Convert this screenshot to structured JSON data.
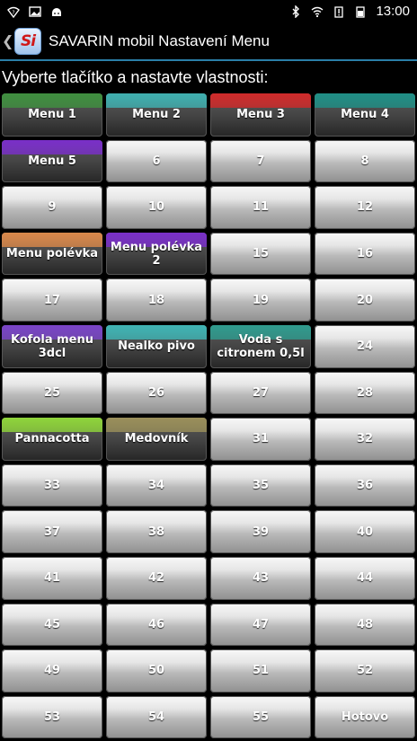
{
  "status_bar": {
    "left_icons": [
      "wifi-question-icon",
      "image-icon",
      "android-icon"
    ],
    "right_icons": [
      "bluetooth-icon",
      "wifi-icon",
      "battery-alert-icon",
      "battery-icon"
    ],
    "time": "13:00"
  },
  "action_bar": {
    "logo_text": "Si",
    "title": "SAVARIN mobil Nastavení Menu"
  },
  "instruction": "Vyberte tlačítko a nastavte vlastnosti:",
  "buttons": [
    {
      "label": "Menu 1",
      "color": "#3f8f3f"
    },
    {
      "label": "Menu 2",
      "color": "#3fb0b0"
    },
    {
      "label": "Menu 3",
      "color": "#d02a2a"
    },
    {
      "label": "Menu 4",
      "color": "#1f8f86"
    },
    {
      "label": "Menu 5",
      "color": "#7a2fc9"
    },
    {
      "label": "6"
    },
    {
      "label": "7"
    },
    {
      "label": "8"
    },
    {
      "label": "9"
    },
    {
      "label": "10"
    },
    {
      "label": "11"
    },
    {
      "label": "12"
    },
    {
      "label": "Menu polévka",
      "color": "#d9884a"
    },
    {
      "label": "Menu polévka 2",
      "color": "#7a2fc9"
    },
    {
      "label": "15"
    },
    {
      "label": "16"
    },
    {
      "label": "17"
    },
    {
      "label": "18"
    },
    {
      "label": "19"
    },
    {
      "label": "20"
    },
    {
      "label": "Kofola menu 3dcl",
      "color": "#7a44c8"
    },
    {
      "label": "Nealko pivo",
      "color": "#3fb5b5"
    },
    {
      "label": "Voda s citronem 0,5l",
      "color": "#2f9b8e"
    },
    {
      "label": "24"
    },
    {
      "label": "25"
    },
    {
      "label": "26"
    },
    {
      "label": "27"
    },
    {
      "label": "28"
    },
    {
      "label": "Pannacotta",
      "color": "#8fd53a"
    },
    {
      "label": "Medovník",
      "color": "#9a8f5a"
    },
    {
      "label": "31"
    },
    {
      "label": "32"
    },
    {
      "label": "33"
    },
    {
      "label": "34"
    },
    {
      "label": "35"
    },
    {
      "label": "36"
    },
    {
      "label": "37"
    },
    {
      "label": "38"
    },
    {
      "label": "39"
    },
    {
      "label": "40"
    },
    {
      "label": "41"
    },
    {
      "label": "42"
    },
    {
      "label": "43"
    },
    {
      "label": "44"
    },
    {
      "label": "45"
    },
    {
      "label": "46"
    },
    {
      "label": "47"
    },
    {
      "label": "48"
    },
    {
      "label": "49"
    },
    {
      "label": "50"
    },
    {
      "label": "51"
    },
    {
      "label": "52"
    },
    {
      "label": "53"
    },
    {
      "label": "54"
    },
    {
      "label": "55"
    },
    {
      "label": "Hotovo"
    }
  ]
}
